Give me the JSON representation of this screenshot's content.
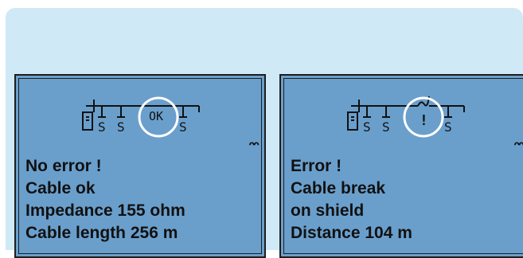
{
  "panels": [
    {
      "status_symbol": "OK",
      "icon": "double-arch-icon",
      "icon_glyph": "ᴖᴖ",
      "lines": [
        "No error !",
        "Cable ok",
        "Impedance 155 ohm",
        "Cable length 256 m"
      ]
    },
    {
      "status_symbol": "!",
      "icon": "double-arch-icon",
      "icon_glyph": "ᴖᴖ",
      "lines": [
        "Error !",
        "Cable break",
        "on shield",
        "Distance 104 m"
      ]
    }
  ],
  "colors": {
    "frame_bg": "#cfe9f7",
    "screen_bg": "#6a9fcc",
    "text": "#111111",
    "highlight_circle": "#ffffff"
  }
}
